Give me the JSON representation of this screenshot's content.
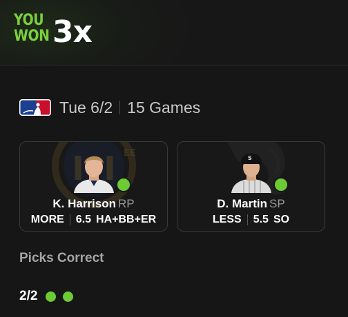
{
  "result": {
    "line1": "YOU",
    "line2": "WON",
    "multiplier": "3x"
  },
  "game": {
    "league_icon": "mlb-logo-icon",
    "date": "Tue 6/2",
    "games": "15 Games"
  },
  "picks": [
    {
      "player": "K. Harrison",
      "position": "RP",
      "choice": "MORE",
      "line": "6.5",
      "stat": "HA+BB+ER",
      "team_icon": "brewers-logo-icon",
      "status": "correct"
    },
    {
      "player": "D. Martin",
      "position": "SP",
      "choice": "LESS",
      "line": "5.5",
      "stat": "SO",
      "team_icon": "white-sox-logo-icon",
      "status": "correct"
    }
  ],
  "summary": {
    "title": "Picks Correct",
    "count": "2/2",
    "correct": 2,
    "total": 2
  },
  "colors": {
    "accent": "#6ccb34",
    "background": "#161616",
    "card_border": "#3a3a3a"
  }
}
